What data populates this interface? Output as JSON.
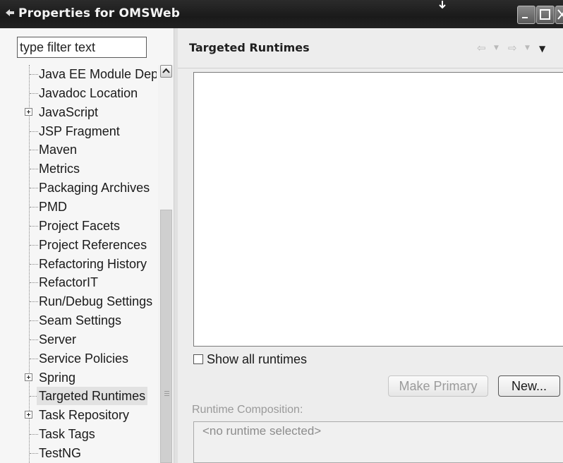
{
  "window": {
    "title": "Properties for OMSWeb"
  },
  "filter": {
    "placeholder": "type filter text"
  },
  "tree": {
    "items": [
      {
        "label": "Java EE Module Dep",
        "expandable": false
      },
      {
        "label": "Javadoc Location",
        "expandable": false
      },
      {
        "label": "JavaScript",
        "expandable": true
      },
      {
        "label": "JSP Fragment",
        "expandable": false
      },
      {
        "label": "Maven",
        "expandable": false
      },
      {
        "label": "Metrics",
        "expandable": false
      },
      {
        "label": "Packaging Archives",
        "expandable": false
      },
      {
        "label": "PMD",
        "expandable": false
      },
      {
        "label": "Project Facets",
        "expandable": false
      },
      {
        "label": "Project References",
        "expandable": false
      },
      {
        "label": "Refactoring History",
        "expandable": false
      },
      {
        "label": "RefactorIT",
        "expandable": false
      },
      {
        "label": "Run/Debug Settings",
        "expandable": false
      },
      {
        "label": "Seam Settings",
        "expandable": false
      },
      {
        "label": "Server",
        "expandable": false
      },
      {
        "label": "Service Policies",
        "expandable": false
      },
      {
        "label": "Spring",
        "expandable": true
      },
      {
        "label": "Targeted Runtimes",
        "expandable": false,
        "selected": true
      },
      {
        "label": "Task Repository",
        "expandable": true
      },
      {
        "label": "Task Tags",
        "expandable": false
      },
      {
        "label": "TestNG",
        "expandable": false
      }
    ]
  },
  "page": {
    "title": "Targeted Runtimes",
    "show_all_label": "Show all runtimes",
    "show_all_checked": false,
    "make_primary_label": "Make Primary",
    "new_label": "New...",
    "composition_label": "Runtime Composition:",
    "composition_value": "<no runtime selected>"
  },
  "icons": [
    "back-arrow-icon",
    "forward-arrow-icon",
    "view-menu-icon",
    "minimize-icon",
    "maximize-icon",
    "close-icon"
  ]
}
